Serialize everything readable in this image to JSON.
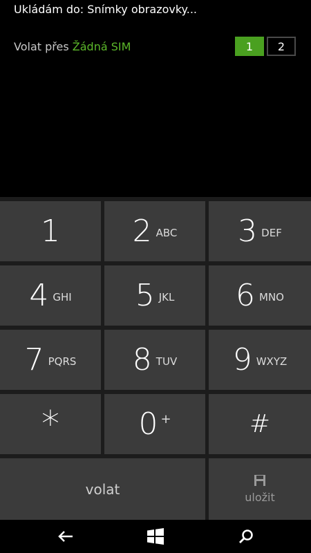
{
  "status": {
    "text": "Ukládám do: Snímky obrazovky..."
  },
  "sim": {
    "prefix": "Volat přes",
    "name": "Žádná SIM",
    "options": [
      "1",
      "2"
    ],
    "selected": "1",
    "active_color": "#4aa020",
    "name_color": "#5cb82a"
  },
  "keypad": {
    "keys": [
      {
        "digit": "1",
        "letters": ""
      },
      {
        "digit": "2",
        "letters": "ABC"
      },
      {
        "digit": "3",
        "letters": "DEF"
      },
      {
        "digit": "4",
        "letters": "GHI"
      },
      {
        "digit": "5",
        "letters": "JKL"
      },
      {
        "digit": "6",
        "letters": "MNO"
      },
      {
        "digit": "7",
        "letters": "PQRS"
      },
      {
        "digit": "8",
        "letters": "TUV"
      },
      {
        "digit": "9",
        "letters": "WXYZ"
      },
      {
        "digit": "*",
        "letters": ""
      },
      {
        "digit": "0",
        "letters": "+"
      },
      {
        "digit": "#",
        "letters": ""
      }
    ],
    "call_label": "volat",
    "save_label": "uložit"
  },
  "navbar": {
    "icons": [
      "back-icon",
      "windows-start-icon",
      "search-icon"
    ]
  }
}
